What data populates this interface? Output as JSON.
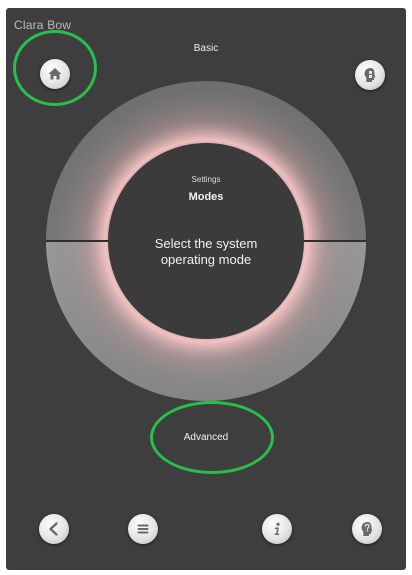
{
  "header": {
    "user_name": "Clara Bow",
    "top_label": "Basic"
  },
  "dial": {
    "category": "Settings",
    "title": "Modes",
    "description_line1": "Select the system",
    "description_line2": "operating mode"
  },
  "footer": {
    "bottom_label": "Advanced"
  },
  "colors": {
    "background": "#3e3e3e",
    "highlight": "#27c04a",
    "glow": "#f5b3b3"
  },
  "icons": {
    "home": "home-icon",
    "profile": "head-profile-icon",
    "back": "chevron-left-icon",
    "menu": "menu-icon",
    "info": "info-icon",
    "help": "head-question-icon"
  }
}
